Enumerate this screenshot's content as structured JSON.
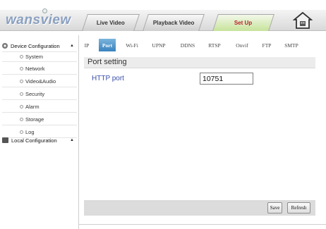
{
  "brand": {
    "logo_text": "wansview"
  },
  "top_tabs": [
    {
      "label": "Live Video",
      "active": false
    },
    {
      "label": "Playback Video",
      "active": false
    },
    {
      "label": "Set Up",
      "active": true
    }
  ],
  "sidebar": {
    "device_config": {
      "label": "Device Configuration",
      "arrow": "▲",
      "icon": "gear-icon"
    },
    "items": [
      {
        "label": "System"
      },
      {
        "label": "Network"
      },
      {
        "label": "Video&Audio"
      },
      {
        "label": "Security"
      },
      {
        "label": "Alarm"
      },
      {
        "label": "Storage"
      },
      {
        "label": "Log"
      }
    ],
    "local_config": {
      "label": "Local Configuration",
      "arrow": "▲",
      "icon": "local-config-icon"
    }
  },
  "subtabs": [
    {
      "label": "IP",
      "active": false
    },
    {
      "label": "Port",
      "active": true
    },
    {
      "label": "Wi-Fi",
      "active": false
    },
    {
      "label": "UPNP",
      "active": false
    },
    {
      "label": "DDNS",
      "active": false
    },
    {
      "label": "RTSP",
      "active": false
    },
    {
      "label": "Onvif",
      "active": false
    },
    {
      "label": "FTP",
      "active": false
    },
    {
      "label": "SMTP",
      "active": false
    }
  ],
  "port_setting": {
    "title": "Port setting",
    "http_port_label": "HTTP port",
    "http_port_value": "10751"
  },
  "buttons": {
    "save": "Save",
    "refresh": "Refresh"
  },
  "colors": {
    "active_tab_text": "#b8232b",
    "active_subtab": "#3a82bf",
    "field_label": "#3a4fa8"
  }
}
